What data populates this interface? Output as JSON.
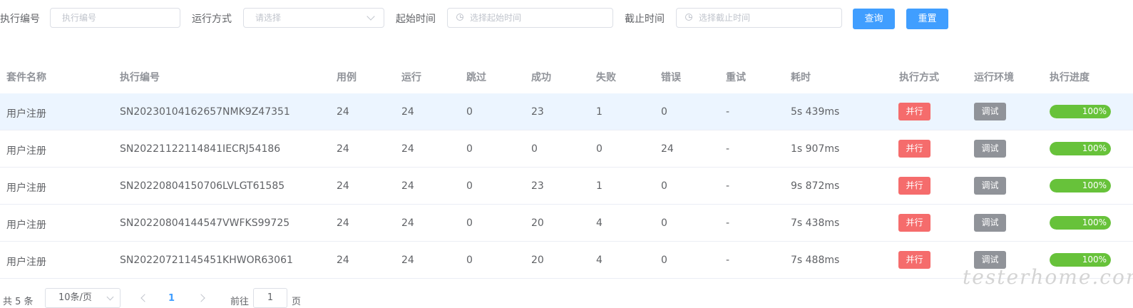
{
  "filters": {
    "exec_no": {
      "label": "执行编号",
      "placeholder": "执行编号"
    },
    "run_mode": {
      "label": "运行方式",
      "placeholder": "请选择"
    },
    "start_time": {
      "label": "起始时间",
      "placeholder": "选择起始时间"
    },
    "end_time": {
      "label": "截止时间",
      "placeholder": "选择截止时间"
    },
    "query_label": "查询",
    "reset_label": "重置"
  },
  "table": {
    "headers": [
      "套件名称",
      "执行编号",
      "用例",
      "运行",
      "跳过",
      "成功",
      "失败",
      "错误",
      "重试",
      "耗时",
      "执行方式",
      "运行环境",
      "执行进度"
    ],
    "rows": [
      {
        "suite": "用户注册",
        "exec_no": "SN20230104162657NMK9Z47351",
        "cases": "24",
        "run": "24",
        "skip": "0",
        "success": "23",
        "fail": "1",
        "error": "0",
        "retry": "-",
        "duration": "5s 439ms",
        "mode": "并行",
        "env": "调试",
        "progress": "100%"
      },
      {
        "suite": "用户注册",
        "exec_no": "SN20221122114841IECRJ54186",
        "cases": "24",
        "run": "24",
        "skip": "0",
        "success": "0",
        "fail": "0",
        "error": "24",
        "retry": "-",
        "duration": "1s 907ms",
        "mode": "并行",
        "env": "调试",
        "progress": "100%"
      },
      {
        "suite": "用户注册",
        "exec_no": "SN20220804150706LVLGT61585",
        "cases": "24",
        "run": "24",
        "skip": "0",
        "success": "23",
        "fail": "1",
        "error": "0",
        "retry": "-",
        "duration": "9s 872ms",
        "mode": "并行",
        "env": "调试",
        "progress": "100%"
      },
      {
        "suite": "用户注册",
        "exec_no": "SN20220804144547VWFKS99725",
        "cases": "24",
        "run": "24",
        "skip": "0",
        "success": "20",
        "fail": "4",
        "error": "0",
        "retry": "-",
        "duration": "7s 438ms",
        "mode": "并行",
        "env": "调试",
        "progress": "100%"
      },
      {
        "suite": "用户注册",
        "exec_no": "SN20220721145451KHWOR63061",
        "cases": "24",
        "run": "24",
        "skip": "0",
        "success": "20",
        "fail": "4",
        "error": "0",
        "retry": "-",
        "duration": "7s 488ms",
        "mode": "并行",
        "env": "调试",
        "progress": "100%"
      }
    ]
  },
  "pagination": {
    "total": "共 5 条",
    "page_size": "10条/页",
    "current_page": "1",
    "goto_label": "前往",
    "goto_value": "1",
    "page_suffix": "页"
  },
  "watermark": "testerhome.com",
  "colors": {
    "primary": "#409eff",
    "tag_parallel": "#f56c6c",
    "tag_env": "#909399",
    "progress": "#67c23a"
  }
}
